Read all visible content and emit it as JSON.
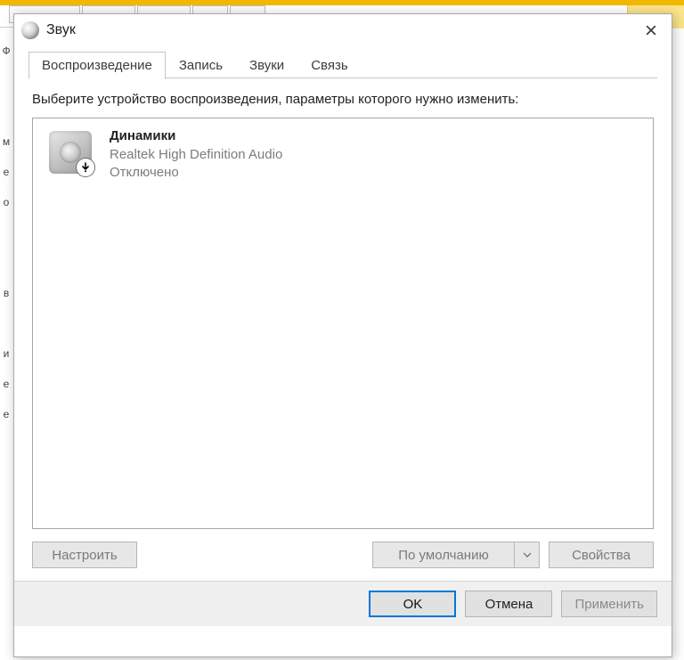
{
  "window": {
    "title": "Звук"
  },
  "tabs": [
    {
      "label": "Воспроизведение",
      "active": true
    },
    {
      "label": "Запись",
      "active": false
    },
    {
      "label": "Звуки",
      "active": false
    },
    {
      "label": "Связь",
      "active": false
    }
  ],
  "instruction": "Выберите устройство воспроизведения, параметры которого нужно изменить:",
  "devices": [
    {
      "name": "Динамики",
      "driver": "Realtek High Definition Audio",
      "status": "Отключено",
      "icon": "speaker-icon",
      "overlay": "down-arrow-overlay"
    }
  ],
  "mid_buttons": {
    "configure": "Настроить",
    "set_default": "По умолчанию",
    "properties": "Свойства"
  },
  "bottom_buttons": {
    "ok": "OK",
    "cancel": "Отмена",
    "apply": "Применить"
  }
}
